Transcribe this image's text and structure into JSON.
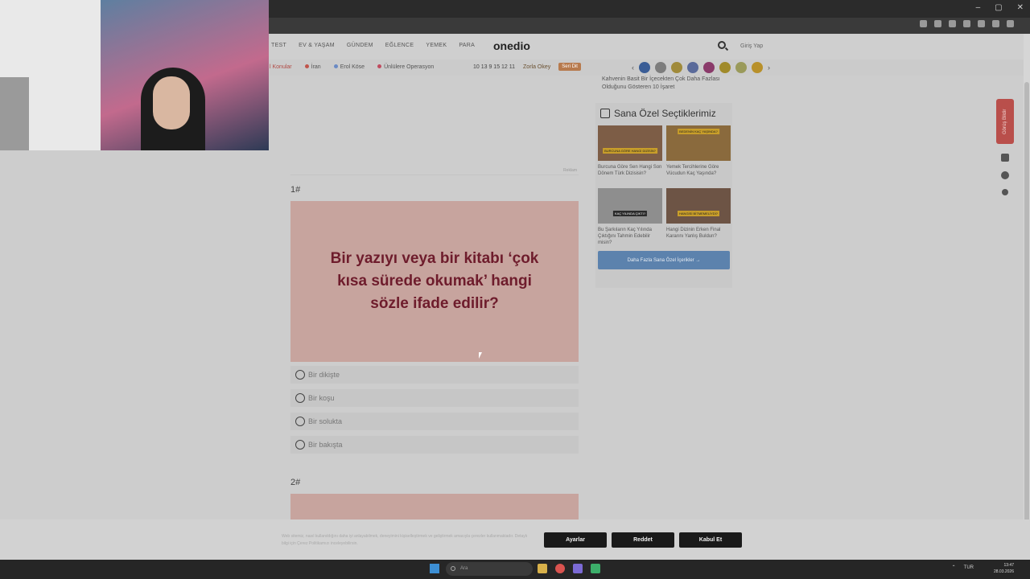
{
  "browser": {
    "window_controls": [
      "–",
      "▢",
      "✕"
    ]
  },
  "site": {
    "logo": "onedio",
    "nav": [
      "TEST",
      "EV & YAŞAM",
      "GÜNDEM",
      "EĞLENCE",
      "YEMEK",
      "PARA"
    ],
    "login": "Giriş Yap",
    "topics": [
      {
        "label": "l Konular",
        "color": ""
      },
      {
        "label": "İran",
        "color": "#c0554b"
      },
      {
        "label": "Erol Köse",
        "color": "#6a8ac4"
      },
      {
        "label": "Ünlülere Operasyon",
        "color": "#c04b5f"
      }
    ],
    "games": {
      "label": "Zorla Okey",
      "button": "Seri Dit",
      "puzzle": "10 13 9 15 12 11"
    }
  },
  "article": {
    "ad_label": "Reklam",
    "q1_num": "1#",
    "q1_text": "Bir yazıyı veya bir kitabı ‘çok kısa sürede okumak’ hangi sözle ifade edilir?",
    "options": [
      "Bir dikişte",
      "Bir koşu",
      "Bir solukta",
      "Bir bakışta"
    ],
    "q2_num": "2#"
  },
  "sidebar": {
    "prev_title": "Kahvenin Basit Bir İçecekten Çok Daha Fazlası Olduğunu Gösteren 10 İşaret",
    "picks_title": "Sana Özel Seçtiklerimiz",
    "picks": [
      {
        "caption": "Burcuna Göre Sen Hangi Son Dönem Türk Dizisisin?",
        "badge": "BURCUNA GÖRE HANGİ DİZİSİN?"
      },
      {
        "caption": "Yemek Tercihlerine Göre Vücudun Kaç Yaşında?",
        "badge": "BEDENİN KAÇ YAŞINDA?"
      },
      {
        "caption": "Bu Şarkıların Kaç Yılında Çıktığını Tahmin Edebilir misin?",
        "badge": "KAÇ YILINDA ÇIKTI?"
      },
      {
        "caption": "Hangi Dizinin Erken Final Kararını Yanlış Buldun?",
        "badge": "HANGİSİ BİTMEMELİYDİ?"
      }
    ],
    "more_button": "Daha Fazla Sana Özel İçerikler →"
  },
  "floating": {
    "feedback": "Görüş Bildir"
  },
  "cookie": {
    "text": "Web sitemiz, nasıl kullanıldığını daha iyi anlayabilmek, deneyimini kişiselleştirmek ve geliştirmek amacıyla çerezler kullanmaktadır. Detaylı bilgi için Çerez Politikamızı inceleyebilirsin.",
    "settings": "Ayarlar",
    "reject": "Reddet",
    "accept": "Kabul Et"
  },
  "taskbar": {
    "search": "Ara",
    "lang": "TUR",
    "time": "13:47",
    "date": "28.03.2026"
  }
}
